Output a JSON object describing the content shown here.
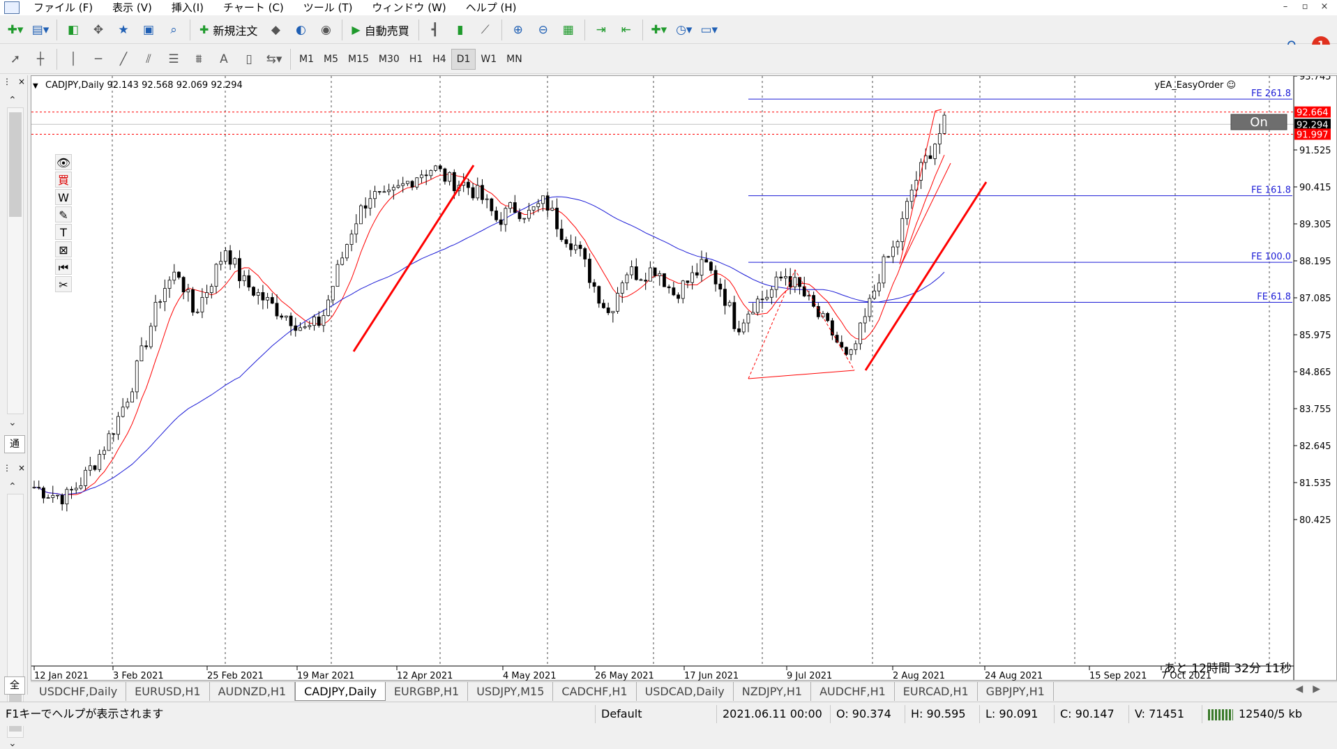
{
  "menubar": {
    "items": [
      "ファイル (F)",
      "表示 (V)",
      "挿入(I)",
      "チャート (C)",
      "ツール (T)",
      "ウィンドウ (W)",
      "ヘルプ (H)"
    ],
    "window_controls": [
      "–",
      "▫",
      "×"
    ]
  },
  "toolbar1": {
    "new_order_label": "新規注文",
    "auto_trade_label": "自動売買",
    "notification_count": "1"
  },
  "toolbar2": {
    "timeframes": [
      "M1",
      "M5",
      "M15",
      "M30",
      "H1",
      "H4",
      "D1",
      "W1",
      "MN"
    ],
    "active_timeframe": "D1"
  },
  "left_panel": {
    "tab1_label": "通",
    "tab2_label": "全"
  },
  "chart": {
    "header": "CADJPY,Daily  92.143 92.568 92.069 92.294",
    "ea_label": "yEA_EasyOrder ☺",
    "on_button": "On",
    "countdown": "あと 12時間  32分 11秒",
    "price_axis": [
      "93.745",
      "91.525",
      "90.415",
      "89.305",
      "88.195",
      "87.085",
      "85.975",
      "84.865",
      "83.755",
      "82.645",
      "81.535",
      "80.425"
    ],
    "price_tags": [
      {
        "label": "92.664",
        "bg": "#ff0000",
        "fg": "#ffffff"
      },
      {
        "label": "92.294",
        "bg": "#000000",
        "fg": "#ffffff"
      },
      {
        "label": "91.997",
        "bg": "#ff0000",
        "fg": "#ffffff"
      }
    ],
    "date_axis": [
      "12 Jan 2021",
      "3 Feb 2021",
      "25 Feb 2021",
      "19 Mar 2021",
      "12 Apr 2021",
      "4 May 2021",
      "26 May 2021",
      "17 Jun 2021",
      "9 Jul 2021",
      "2 Aug 2021",
      "24 Aug 2021",
      "15 Sep 2021",
      "7 Oct 2021"
    ],
    "fib_levels": [
      {
        "label": "FE 261.8",
        "price": 93.05
      },
      {
        "label": "FE 161.8",
        "price": 90.15
      },
      {
        "label": "FE 100.0",
        "price": 88.15
      },
      {
        "label": "FE 61.8",
        "price": 86.95
      }
    ],
    "colors": {
      "fast_ma": "#ff0000",
      "slow_ma": "#1a1ad6",
      "fib": "#1a1ad6",
      "trend": "#ff0000",
      "up_candle": "#ffffff",
      "down_candle": "#000000"
    }
  },
  "chart_data": {
    "type": "candlestick",
    "title": "CADJPY,Daily",
    "ohlc_current": {
      "open": 92.143,
      "high": 92.568,
      "low": 92.069,
      "close": 92.294
    },
    "ylim": [
      80.0,
      94.0
    ],
    "xlabels": [
      "12 Jan 2021",
      "3 Feb 2021",
      "25 Feb 2021",
      "19 Mar 2021",
      "12 Apr 2021",
      "4 May 2021",
      "26 May 2021",
      "17 Jun 2021",
      "9 Jul 2021",
      "2 Aug 2021",
      "24 Aug 2021",
      "15 Sep 2021",
      "7 Oct 2021"
    ],
    "close_anchors": [
      81.4,
      81.2,
      81.1,
      81.6,
      82.3,
      83.2,
      84.3,
      85.8,
      87.3,
      87.9,
      86.6,
      87.5,
      88.6,
      87.6,
      87.2,
      86.8,
      86.5,
      86.1,
      86.4,
      87.9,
      89.3,
      90.2,
      90.0,
      90.4,
      90.8,
      91.0,
      90.6,
      90.5,
      90.1,
      89.4,
      89.8,
      89.6,
      90.0,
      89.1,
      88.6,
      87.5,
      86.6,
      87.9,
      87.8,
      88.0,
      87.2,
      87.6,
      88.1,
      87.4,
      86.2,
      86.9,
      87.2,
      87.8,
      87.3,
      86.6,
      86.0,
      85.1,
      86.4,
      87.9,
      88.7,
      90.4,
      91.4,
      92.3
    ]
  },
  "drawing_tools": [
    "eye-icon",
    "buy-icon",
    "w-icon",
    "pen-icon",
    "text-icon",
    "shape-icon",
    "rewind-icon",
    "scissors-icon"
  ],
  "bottom_tabs": [
    "USDCHF,Daily",
    "EURUSD,H1",
    "AUDNZD,H1",
    "CADJPY,Daily",
    "EURGBP,H1",
    "USDJPY,M15",
    "CADCHF,H1",
    "USDCAD,Daily",
    "NZDJPY,H1",
    "AUDCHF,H1",
    "EURCAD,H1",
    "GBPJPY,H1"
  ],
  "active_tab": "CADJPY,Daily",
  "statusbar": {
    "help": "F1キーでヘルプが表示されます",
    "profile": "Default",
    "datetime": "2021.06.11 00:00",
    "open": "O: 90.374",
    "high": "H: 90.595",
    "low": "L: 90.091",
    "close": "C: 90.147",
    "volume": "V: 71451",
    "traffic": "12540/5 kb"
  }
}
